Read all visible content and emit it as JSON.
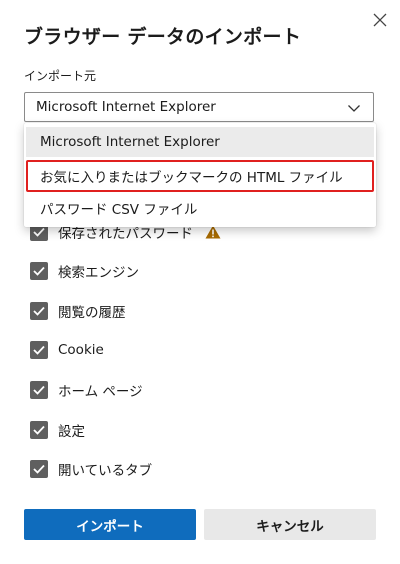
{
  "dialog": {
    "title": "ブラウザー データのインポート",
    "close_icon": "close-icon"
  },
  "import_from": {
    "label": "インポート元",
    "selected_value": "Microsoft Internet Explorer"
  },
  "dropdown": {
    "options": [
      "Microsoft Internet Explorer",
      "お気に入りまたはブックマークの HTML ファイル",
      "パスワード CSV ファイル"
    ]
  },
  "items": [
    {
      "label": "保存されたパスワード",
      "checked": true
    },
    {
      "label": "検索エンジン",
      "checked": true
    },
    {
      "label": "閲覧の履歴",
      "checked": true
    },
    {
      "label": "Cookie",
      "checked": true
    },
    {
      "label": "ホーム ページ",
      "checked": true
    },
    {
      "label": "設定",
      "checked": true
    },
    {
      "label": "開いているタブ",
      "checked": true
    }
  ],
  "buttons": {
    "import": "インポート",
    "cancel": "キャンセル"
  },
  "colors": {
    "primary": "#0f6cbd",
    "highlight_border": "#e0201f",
    "warning": "#a86b00",
    "checkbox": "#5f5f5f"
  }
}
